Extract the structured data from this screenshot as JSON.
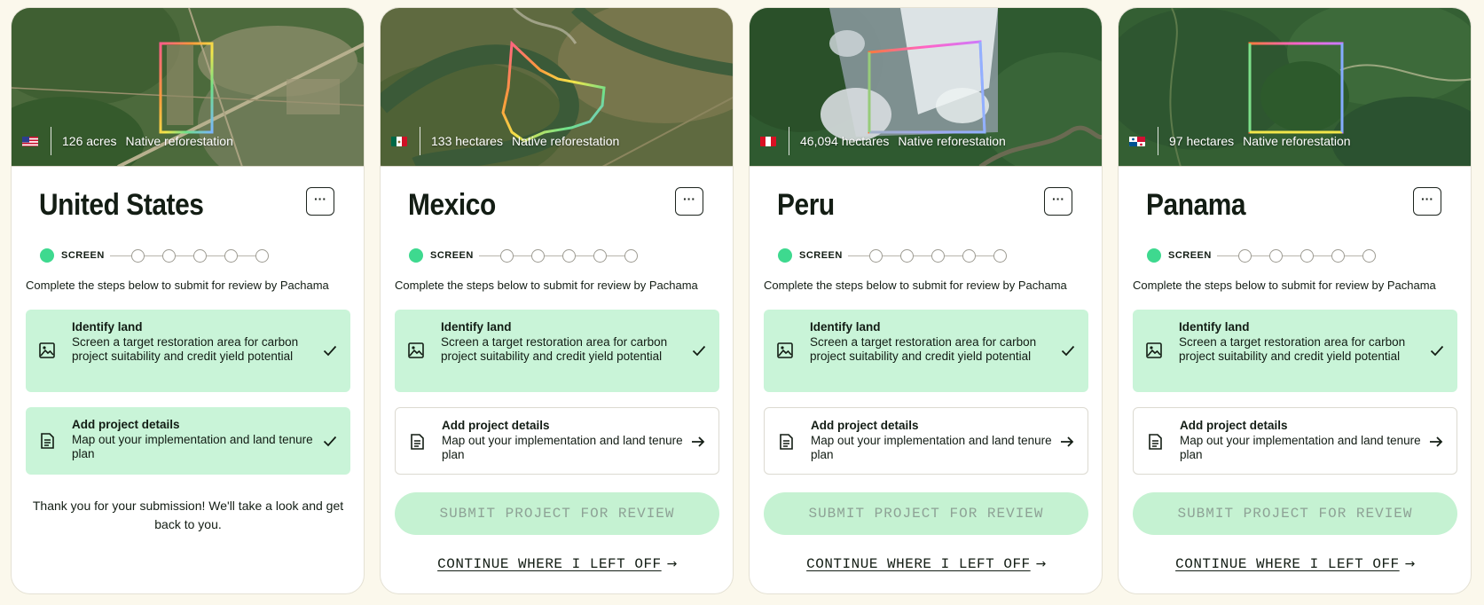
{
  "common": {
    "step_label": "SCREEN",
    "instructions": "Complete the steps below to submit for review by Pachama",
    "menu_label": "···",
    "task1": {
      "title": "Identify land",
      "desc": "Screen a target restoration area for carbon project suitability and credit yield potential",
      "icon": "image-icon"
    },
    "task2": {
      "title": "Add project details",
      "desc": "Map out your implementation and land tenure plan",
      "icon": "document-icon"
    },
    "submit_label": "SUBMIT PROJECT FOR REVIEW",
    "continue_label": "CONTINUE WHERE I LEFT OFF",
    "continue_arrow": "→",
    "colors": {
      "accent_green": "#3ed98f",
      "done_bg": "#c9f4d8",
      "submit_bg": "#c5f2d2",
      "page_bg": "#fbf8ec"
    }
  },
  "projects": [
    {
      "country": "United States",
      "flag": "us-flag-icon",
      "area": "126 acres",
      "type": "Native reforestation",
      "steps_done": 1,
      "task1_status": "done",
      "task2_status": "done",
      "thanks": "Thank you for your submission! We'll take a look and get back to you."
    },
    {
      "country": "Mexico",
      "flag": "mx-flag-icon",
      "area": "133 hectares",
      "type": "Native reforestation",
      "steps_done": 1,
      "task1_status": "done",
      "task2_status": "todo"
    },
    {
      "country": "Peru",
      "flag": "pe-flag-icon",
      "area": "46,094 hectares",
      "type": "Native reforestation",
      "steps_done": 1,
      "task1_status": "done",
      "task2_status": "todo"
    },
    {
      "country": "Panama",
      "flag": "pa-flag-icon",
      "area": "97 hectares",
      "type": "Native reforestation",
      "steps_done": 1,
      "task1_status": "done",
      "task2_status": "todo"
    }
  ]
}
